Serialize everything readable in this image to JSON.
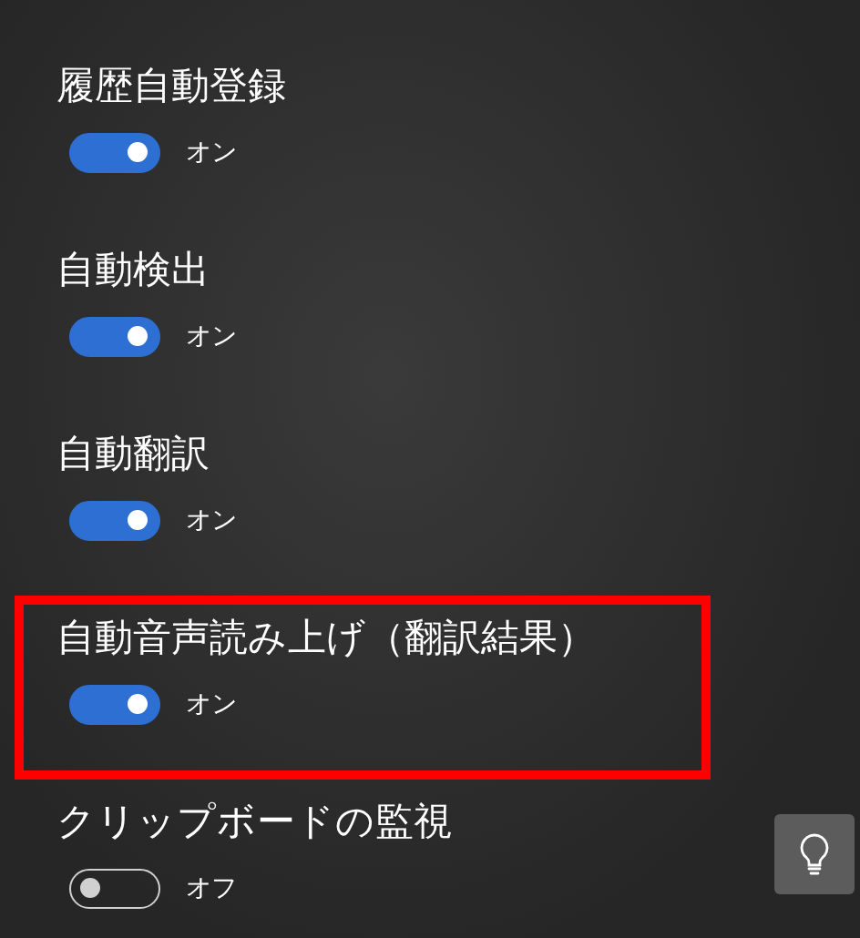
{
  "settings": [
    {
      "label": "履歴自動登録",
      "on": true,
      "state_text": "オン",
      "highlighted": false
    },
    {
      "label": "自動検出",
      "on": true,
      "state_text": "オン",
      "highlighted": false
    },
    {
      "label": "自動翻訳",
      "on": true,
      "state_text": "オン",
      "highlighted": false
    },
    {
      "label": "自動音声読み上げ（翻訳結果）",
      "on": true,
      "state_text": "オン",
      "highlighted": true
    },
    {
      "label": "クリップボードの監視",
      "on": false,
      "state_text": "オフ",
      "highlighted": false
    }
  ],
  "tip_button": {
    "kind": "lightbulb"
  }
}
